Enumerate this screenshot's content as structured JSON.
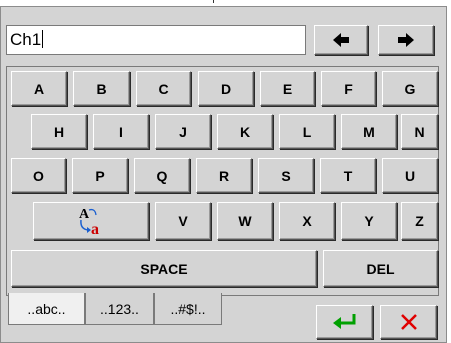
{
  "input": {
    "value": "Ch1"
  },
  "nav": {
    "left_icon": "arrow-left-icon",
    "right_icon": "arrow-right-icon"
  },
  "keyboard": {
    "row1": [
      "A",
      "B",
      "C",
      "D",
      "E",
      "F",
      "G"
    ],
    "row2": [
      "H",
      "I",
      "J",
      "K",
      "L",
      "M",
      "N"
    ],
    "row3": [
      "O",
      "P",
      "Q",
      "R",
      "S",
      "T",
      "U"
    ],
    "row4": [
      "V",
      "W",
      "X",
      "Y",
      "Z"
    ],
    "case_toggle_icon": "case-toggle-icon",
    "space_label": "SPACE",
    "del_label": "DEL"
  },
  "tabs": [
    "..abc..",
    "..123..",
    "..#$!.."
  ],
  "actions": {
    "enter_icon": "enter-icon",
    "cancel_icon": "close-icon"
  },
  "colors": {
    "enter": "#00a000",
    "cancel": "#e00000",
    "case_a": "#cc0000",
    "case_arrow": "#1a5fd0"
  }
}
